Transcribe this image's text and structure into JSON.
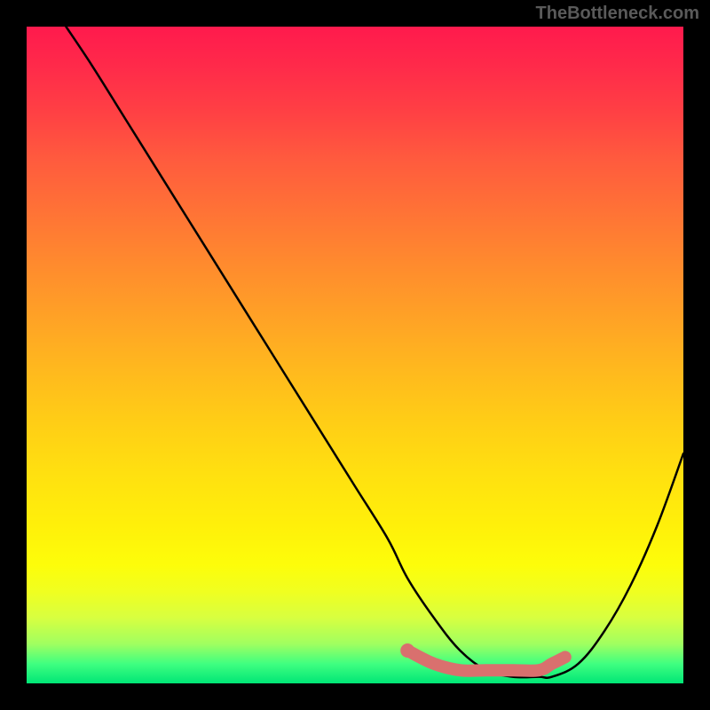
{
  "watermark": "TheBottleneck.com",
  "chart_data": {
    "type": "line",
    "title": "",
    "xlabel": "",
    "ylabel": "",
    "xlim": [
      0,
      100
    ],
    "ylim": [
      0,
      100
    ],
    "grid": false,
    "series": [
      {
        "name": "curve",
        "x": [
          6,
          10,
          15,
          20,
          25,
          30,
          35,
          40,
          45,
          50,
          55,
          58,
          62,
          66,
          70,
          74,
          78,
          80,
          84,
          88,
          92,
          96,
          100
        ],
        "values": [
          100,
          94,
          86,
          78,
          70,
          62,
          54,
          46,
          38,
          30,
          22,
          16,
          10,
          5,
          2,
          1,
          1,
          1,
          3,
          8,
          15,
          24,
          35
        ]
      }
    ],
    "highlight": {
      "color": "#d9706e",
      "x": [
        58,
        62,
        66,
        70,
        74,
        78,
        80,
        82
      ],
      "values": [
        5,
        3,
        2,
        2,
        2,
        2,
        3,
        4
      ]
    },
    "gradient_stops": [
      {
        "pos": 0.0,
        "color": "#ff1a4d"
      },
      {
        "pos": 0.25,
        "color": "#ff7a32"
      },
      {
        "pos": 0.5,
        "color": "#ffc21a"
      },
      {
        "pos": 0.75,
        "color": "#fff60c"
      },
      {
        "pos": 0.92,
        "color": "#c8ff4a"
      },
      {
        "pos": 1.0,
        "color": "#00e676"
      }
    ]
  }
}
